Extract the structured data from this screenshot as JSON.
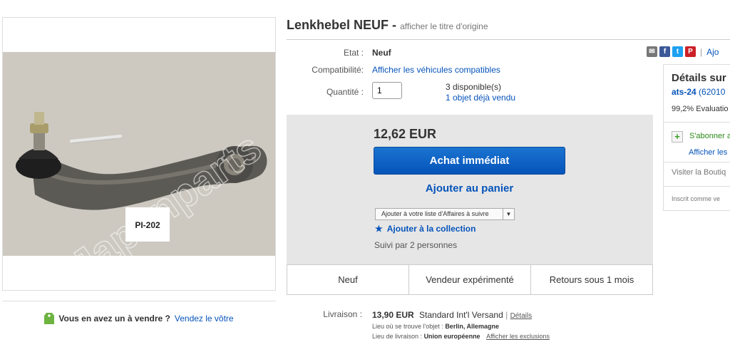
{
  "product": {
    "title": "Lenkhebel NEUF",
    "title_sep": "-",
    "original_title_link": "afficher le titre d'origine",
    "image_part_label": "PI-202",
    "image_watermark": "Japanparts"
  },
  "details": {
    "condition_label": "Etat :",
    "condition_value": "Neuf",
    "compat_label": "Compatibilité:",
    "compat_link": "Afficher les véhicules compatibles",
    "qty_label": "Quantité :",
    "qty_value": "1",
    "available": "3 disponible(s)",
    "sold": "1 objet déjà vendu"
  },
  "buy": {
    "price": "12,62 EUR",
    "buy_now": "Achat immédiat",
    "add_cart": "Ajouter au panier",
    "watch_select": "Ajouter à votre liste d'Affaires à suivre",
    "add_collection": "Ajouter à la collection",
    "followers": "Suivi par 2 personnes"
  },
  "features": [
    "Neuf",
    "Vendeur expérimenté",
    "Retours sous 1 mois"
  ],
  "shipping": {
    "label": "Livraison :",
    "cost": "13,90 EUR",
    "method": "Standard Int'l Versand",
    "sep": "|",
    "details_link": "Détails",
    "location_label": "Lieu où se trouve l'objet :",
    "location": "Berlin, Allemagne",
    "delivery_label": "Lieu de livraison :",
    "delivery": "Union européenne",
    "exclusions_link": "Afficher les exclusions"
  },
  "sell": {
    "question": "Vous en avez un à vendre ?",
    "link": "Vendez le vôtre"
  },
  "share": {
    "sep": "|",
    "add_link": "Ajo"
  },
  "seller": {
    "heading": "Détails sur",
    "name": "ats-24",
    "count": "(62010",
    "score": "99,2% Evaluatio",
    "subscribe": "S'abonner a",
    "items": "Afficher les",
    "store": "Visiter la Boutiq",
    "registered": "Inscrit comme ve"
  },
  "colors": {
    "link": "#0654ba",
    "buy_button": "#0654ba",
    "buybox_bg": "#e6e6e6",
    "green": "#3a9d23"
  }
}
